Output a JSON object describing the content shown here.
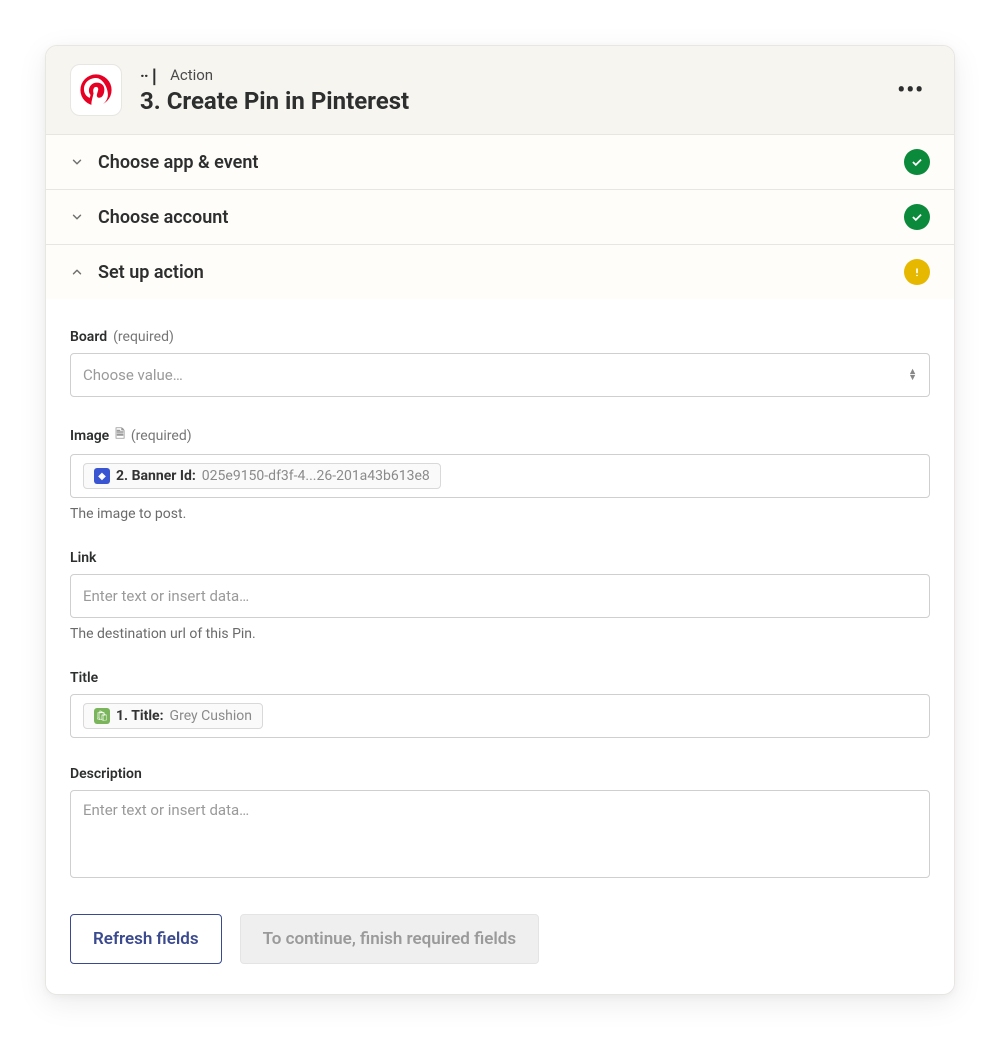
{
  "header": {
    "kicker": "Action",
    "title": "3. Create Pin in Pinterest"
  },
  "sections": {
    "app_event": {
      "title": "Choose app & event",
      "status": "success"
    },
    "account": {
      "title": "Choose account",
      "status": "success"
    },
    "setup": {
      "title": "Set up action",
      "status": "warn"
    }
  },
  "form": {
    "board": {
      "label": "Board",
      "required": "(required)",
      "placeholder": "Choose value…"
    },
    "image": {
      "label": "Image",
      "required": "(required)",
      "pill_label": "2. Banner Id:",
      "pill_value": "025e9150-df3f-4...26-201a43b613e8",
      "help": "The image to post."
    },
    "link": {
      "label": "Link",
      "placeholder": "Enter text or insert data…",
      "help": "The destination url of this Pin."
    },
    "title": {
      "label": "Title",
      "pill_label": "1. Title:",
      "pill_value": "Grey  Cushion"
    },
    "description": {
      "label": "Description",
      "placeholder": "Enter text or insert data…"
    }
  },
  "buttons": {
    "refresh": "Refresh fields",
    "continue_disabled": "To continue, finish required fields"
  }
}
